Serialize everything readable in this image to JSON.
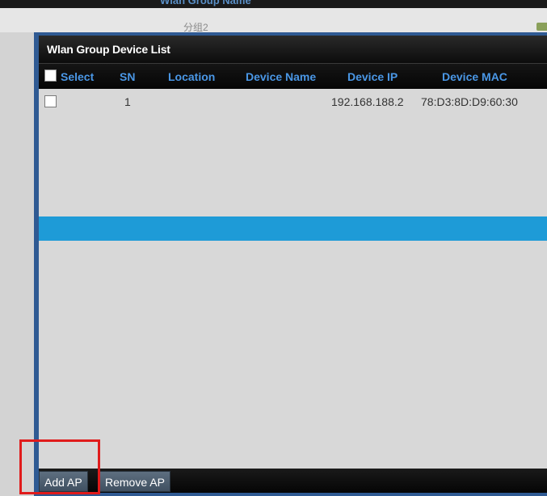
{
  "background": {
    "header_text": "Wlan Group Name",
    "row_text": "分组2"
  },
  "dialog": {
    "title": "Wlan Group Device List",
    "columns": [
      "Select",
      "SN",
      "Location",
      "Device Name",
      "Device IP",
      "Device MAC"
    ],
    "rows": [
      {
        "sn": "1",
        "location": "",
        "device_name": "",
        "device_ip": "192.168.188.2",
        "device_mac": "78:D3:8D:D9:60:30"
      }
    ],
    "buttons": {
      "add": "Add AP",
      "remove": "Remove AP"
    }
  },
  "colors": {
    "dialog_border": "#2f5a93",
    "header_text": "#4a97e6",
    "highlight_bar": "#1e9bd7",
    "annotation": "#e01b1b"
  }
}
